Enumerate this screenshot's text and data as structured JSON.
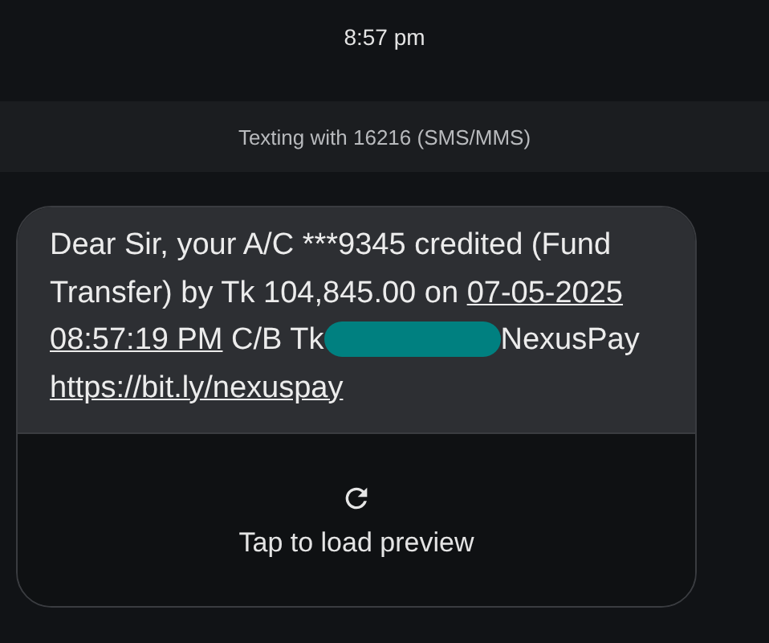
{
  "timestamp": "8:57 pm",
  "banner": "Texting with 16216 (SMS/MMS)",
  "message": {
    "segments": [
      {
        "kind": "text",
        "text": "Dear Sir, your A/C ***9345 credited (Fund Transfer) by Tk 104,845.00 on "
      },
      {
        "kind": "link",
        "text": "07-05-2025"
      },
      {
        "kind": "link",
        "text": "08:57:19 PM"
      },
      {
        "kind": "text",
        "text": " C/B Tk"
      },
      {
        "kind": "redaction"
      },
      {
        "kind": "text",
        "text": "NexusPay"
      },
      {
        "kind": "link",
        "text": "https://bit.ly/nexuspay"
      }
    ],
    "preview": {
      "label": "Tap to load preview"
    }
  }
}
